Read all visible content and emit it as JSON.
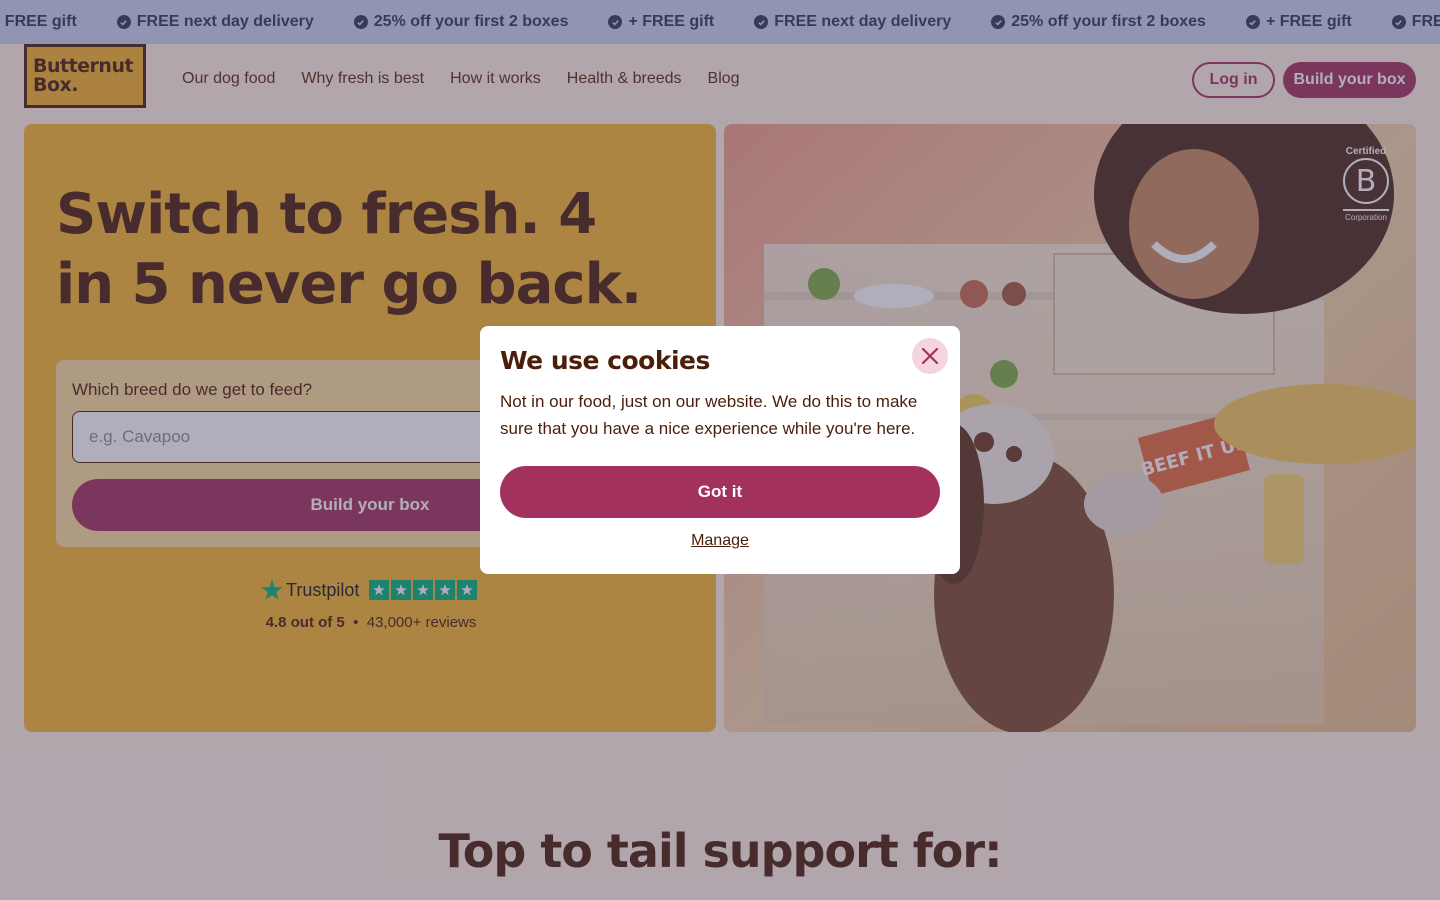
{
  "promo": {
    "items": [
      "+ FREE gift",
      "FREE next day delivery",
      "25% off your first 2 boxes",
      "+ FREE gift",
      "FREE next day delivery",
      "25% off your first 2 boxes",
      "+ FREE gift",
      "FREE next day delivery"
    ]
  },
  "header": {
    "logo_line1": "Butternut",
    "logo_line2": "Box.",
    "nav": [
      "Our dog food",
      "Why fresh is best",
      "How it works",
      "Health & breeds",
      "Blog"
    ],
    "login_label": "Log in",
    "build_label": "Build your box"
  },
  "hero": {
    "title": "Switch to fresh. 4 in 5 never go back.",
    "breed_label": "Which breed do we get to feed?",
    "breed_placeholder": "e.g. Cavapoo",
    "build_label": "Build your box",
    "trust": {
      "brand": "Trustpilot",
      "rating": 4.8,
      "score_text": "4.8 out of 5",
      "separator": "•",
      "reviews_text": "43,000+ reviews"
    },
    "bcorp": {
      "top": "Certified",
      "letter": "B",
      "bottom": "Corporation"
    },
    "photo_label": "BEEF IT UP"
  },
  "section": {
    "title": "Top to tail support for:"
  },
  "cookie_modal": {
    "title": "We use cookies",
    "body": "Not in our food, just on our website. We do this to make sure that you have a nice experience while you're here.",
    "accept_label": "Got it",
    "manage_label": "Manage"
  },
  "colors": {
    "brand": "#a3315e",
    "hero_bg": "#f5b82b",
    "ticker_bg": "#c9d4ee",
    "text_dark": "#4a1e0a",
    "trustpilot": "#00b67a"
  }
}
